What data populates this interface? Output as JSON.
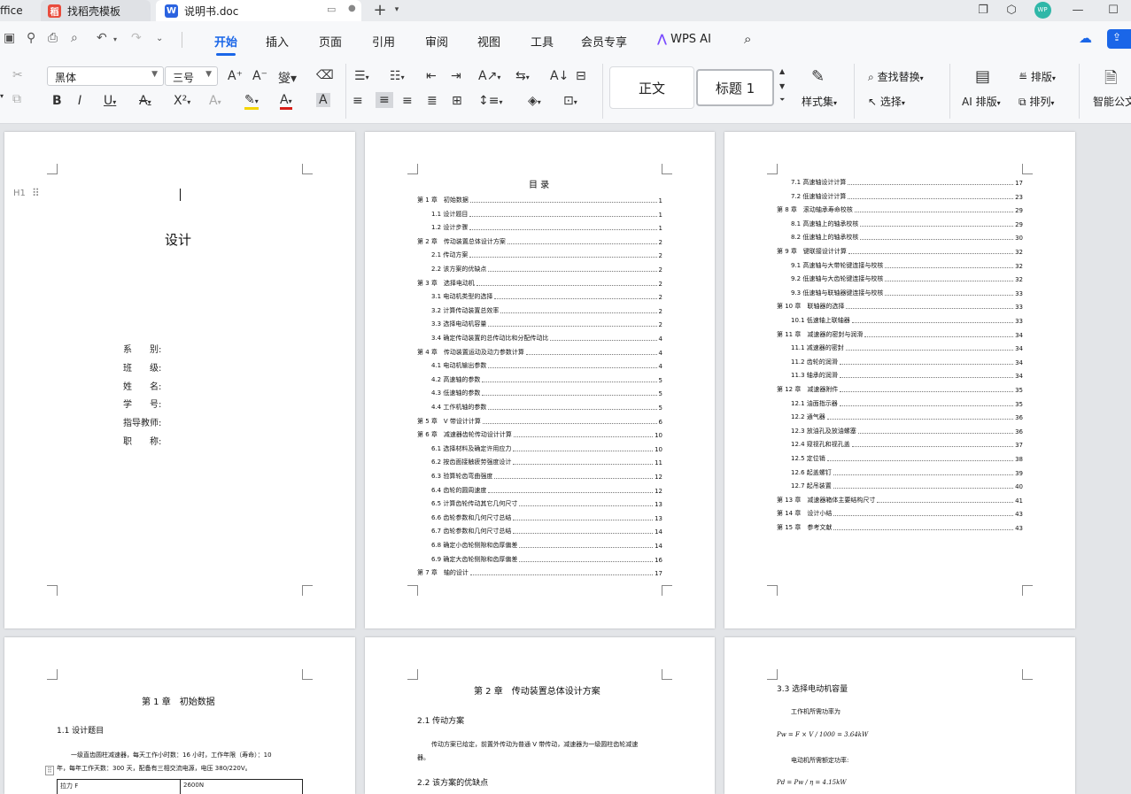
{
  "tabs": {
    "partial_label": "ffice",
    "template_label": "找稻壳模板",
    "doc_label": "说明书.doc",
    "new_tab": "+"
  },
  "window": {
    "avatar_text": "WP",
    "minimize": "—",
    "maximize": "☐"
  },
  "menu": {
    "items": [
      "开始",
      "插入",
      "页面",
      "引用",
      "审阅",
      "视图",
      "工具",
      "会员专享"
    ],
    "ai": "WPS AI"
  },
  "ribbon": {
    "font_name": "黑体",
    "font_size": "三号",
    "style_normal": "正文",
    "style_heading": "标题 1",
    "style_set": "样式集",
    "find_replace": "查找替换",
    "select": "选择",
    "ai_layout": "AI 排版",
    "layout": "排版",
    "arrange": "排列",
    "smart_doc": "智能公文"
  },
  "cover": {
    "title": "设计",
    "fields": [
      "系　　别:",
      "班　　级:",
      "姓　　名:",
      "学　　号:",
      "指导教师:",
      "职　　称:"
    ],
    "heading_marker": "H1"
  },
  "toc_title": "目  录",
  "toc1": [
    {
      "t": "第 1 章　初始数据",
      "p": "1",
      "lvl": 1
    },
    {
      "t": "1.1 设计题目",
      "p": "1",
      "lvl": 2
    },
    {
      "t": "1.2 设计步骤",
      "p": "1",
      "lvl": 2
    },
    {
      "t": "第 2 章　传动装置总体设计方案",
      "p": "2",
      "lvl": 1
    },
    {
      "t": "2.1 传动方案",
      "p": "2",
      "lvl": 2
    },
    {
      "t": "2.2 该方案的优缺点",
      "p": "2",
      "lvl": 2
    },
    {
      "t": "第 3 章　选择电动机",
      "p": "2",
      "lvl": 1
    },
    {
      "t": "3.1 电动机类型的选择",
      "p": "2",
      "lvl": 2
    },
    {
      "t": "3.2 计算传动装置总效率",
      "p": "2",
      "lvl": 2
    },
    {
      "t": "3.3 选择电动机容量",
      "p": "2",
      "lvl": 2
    },
    {
      "t": "3.4 确定传动装置的总传动比和分配传动比",
      "p": "4",
      "lvl": 2
    },
    {
      "t": "第 4 章　传动装置运动及动力参数计算",
      "p": "4",
      "lvl": 1
    },
    {
      "t": "4.1 电动机输出参数",
      "p": "4",
      "lvl": 2
    },
    {
      "t": "4.2 高速轴的参数",
      "p": "5",
      "lvl": 2
    },
    {
      "t": "4.3 低速轴的参数",
      "p": "5",
      "lvl": 2
    },
    {
      "t": "4.4 工作机轴的参数",
      "p": "5",
      "lvl": 2
    },
    {
      "t": "第 5 章　V 带设计计算",
      "p": "6",
      "lvl": 1
    },
    {
      "t": "第 6 章　减速器齿轮传动设计计算",
      "p": "10",
      "lvl": 1
    },
    {
      "t": "6.1 选择材料及确定许用应力",
      "p": "10",
      "lvl": 2
    },
    {
      "t": "6.2 按齿面接触疲劳强度设计",
      "p": "11",
      "lvl": 2
    },
    {
      "t": "6.3 验算轮齿弯曲强度",
      "p": "12",
      "lvl": 2
    },
    {
      "t": "6.4 齿轮的圆周速度",
      "p": "12",
      "lvl": 2
    },
    {
      "t": "6.5 计算齿轮传动其它几何尺寸",
      "p": "13",
      "lvl": 2
    },
    {
      "t": "6.6 齿轮参数和几何尺寸总结",
      "p": "13",
      "lvl": 2
    },
    {
      "t": "6.7 齿轮参数和几何尺寸总结",
      "p": "14",
      "lvl": 2
    },
    {
      "t": "6.8 确定小齿轮侧隙和齿厚偏差",
      "p": "14",
      "lvl": 2
    },
    {
      "t": "6.9 确定大齿轮侧隙和齿厚偏差",
      "p": "16",
      "lvl": 2
    },
    {
      "t": "第 7 章　轴的设计",
      "p": "17",
      "lvl": 1
    }
  ],
  "toc2": [
    {
      "t": "7.1 高速轴设计计算",
      "p": "17",
      "lvl": 2
    },
    {
      "t": "7.2 低速轴设计计算",
      "p": "23",
      "lvl": 2
    },
    {
      "t": "第 8 章　滚动轴承寿命校核",
      "p": "29",
      "lvl": 1
    },
    {
      "t": "8.1 高速轴上的轴承校核",
      "p": "29",
      "lvl": 2
    },
    {
      "t": "8.2 低速轴上的轴承校核",
      "p": "30",
      "lvl": 2
    },
    {
      "t": "第 9 章　键联接设计计算",
      "p": "32",
      "lvl": 1
    },
    {
      "t": "9.1 高速轴与大带轮键连接与校核",
      "p": "32",
      "lvl": 2
    },
    {
      "t": "9.2 低速轴与大齿轮键连接与校核",
      "p": "32",
      "lvl": 2
    },
    {
      "t": "9.3 低速轴与联轴器键连接与校核",
      "p": "33",
      "lvl": 2
    },
    {
      "t": "第 10 章　联轴器的选择",
      "p": "33",
      "lvl": 1
    },
    {
      "t": "10.1 低速轴上联轴器",
      "p": "33",
      "lvl": 2
    },
    {
      "t": "第 11 章　减速器的密封与润滑",
      "p": "34",
      "lvl": 1
    },
    {
      "t": "11.1 减速器的密封",
      "p": "34",
      "lvl": 2
    },
    {
      "t": "11.2 齿轮的润滑",
      "p": "34",
      "lvl": 2
    },
    {
      "t": "11.3 轴承的润滑",
      "p": "34",
      "lvl": 2
    },
    {
      "t": "第 12 章　减速器附件",
      "p": "35",
      "lvl": 1
    },
    {
      "t": "12.1 油面指示器",
      "p": "35",
      "lvl": 2
    },
    {
      "t": "12.2 通气器",
      "p": "36",
      "lvl": 2
    },
    {
      "t": "12.3 放油孔及放油螺塞",
      "p": "36",
      "lvl": 2
    },
    {
      "t": "12.4 窥视孔和视孔盖",
      "p": "37",
      "lvl": 2
    },
    {
      "t": "12.5 定位销",
      "p": "38",
      "lvl": 2
    },
    {
      "t": "12.6 起盖螺钉",
      "p": "39",
      "lvl": 2
    },
    {
      "t": "12.7 起吊装置",
      "p": "40",
      "lvl": 2
    },
    {
      "t": "第 13 章　减速器箱体主要结构尺寸",
      "p": "41",
      "lvl": 1
    },
    {
      "t": "第 14 章　设计小结",
      "p": "43",
      "lvl": 1
    },
    {
      "t": "第 15 章　参考文献",
      "p": "43",
      "lvl": 1
    }
  ],
  "page4": {
    "chapter": "第 1 章　初始数据",
    "section": "1.1 设计题目",
    "para1": "一级直齿圆柱减速器，每天工作小时数：16 小时，工作年限（寿命）：10",
    "para2": "年，每年工作天数：300 天，配备有三相交流电源，电压 380/220V。",
    "cell1": "拉力 F",
    "cell2": "2600N"
  },
  "page5": {
    "chapter": "第 2 章　传动装置总体设计方案",
    "s1": "2.1 传动方案",
    "p1": "传动方案已给定，前置外传动为普通 V 带传动，减速器为一级圆柱齿轮减速",
    "p2": "器。",
    "s2": "2.2 该方案的优缺点"
  },
  "page6": {
    "section": "3.3 选择电动机容量",
    "l1": "工作机所需功率为",
    "f1": "Pw = F × V / 1000 = 3.64kW",
    "l2": "电动机所需额定功率:",
    "f2": "Pd = Pw / η = 4.15kW"
  }
}
